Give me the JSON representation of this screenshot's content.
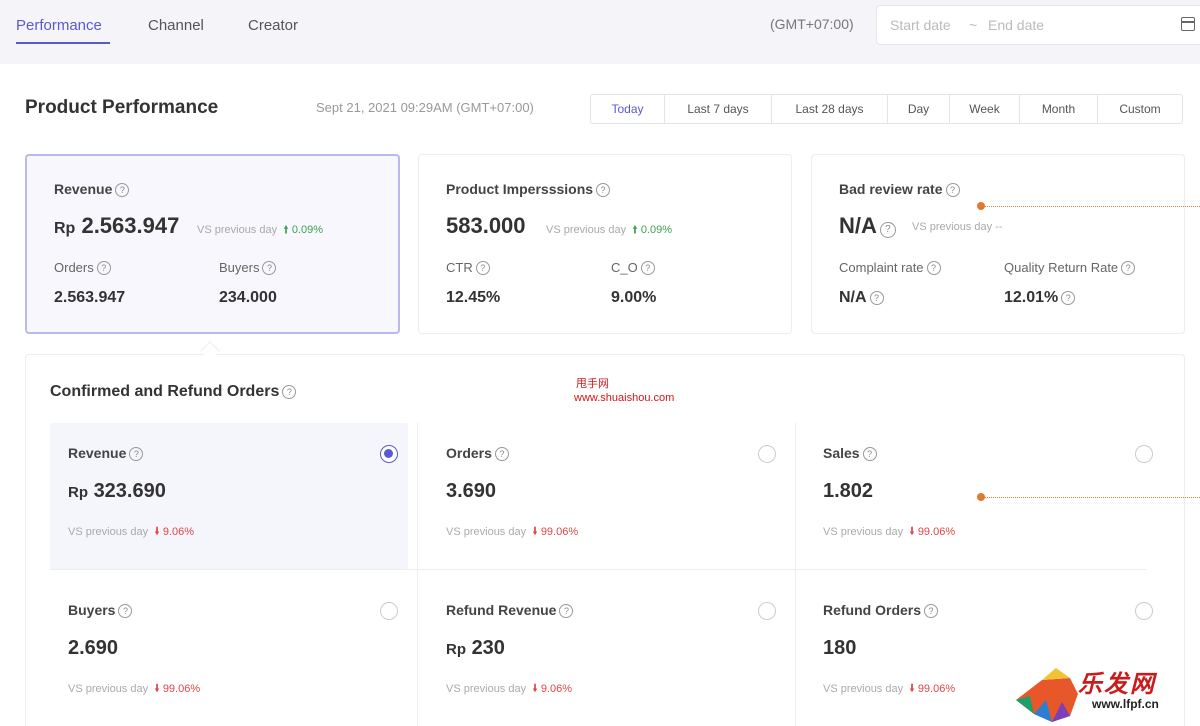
{
  "nav": {
    "tabs": [
      "Performance",
      "Channel",
      "Creator"
    ],
    "timezone": "(GMT+07:00)",
    "start_placeholder": "Start date",
    "separator": "~",
    "end_placeholder": "End date"
  },
  "product_performance": {
    "title": "Product Performance",
    "timestamp": "Sept 21, 2021 09:29AM (GMT+07:00)",
    "ranges": [
      "Today",
      "Last 7 days",
      "Last 28 days",
      "Day",
      "Week",
      "Month",
      "Custom"
    ]
  },
  "cards": {
    "revenue": {
      "label": "Revenue",
      "currency": "Rp",
      "value": "2.563.947",
      "vs": "VS previous day",
      "change": "0.09%",
      "orders_label": "Orders",
      "orders_value": "2.563.947",
      "buyers_label": "Buyers",
      "buyers_value": "234.000"
    },
    "impressions": {
      "label": "Product Impersssions",
      "value": "583.000",
      "vs": "VS previous day",
      "change": "0.09%",
      "ctr_label": "CTR",
      "ctr_value": "12.45%",
      "co_label": "C_O",
      "co_value": "9.00%"
    },
    "bad_review": {
      "label": "Bad review rate",
      "value": "N/A",
      "vs": "VS previous day --",
      "complaint_label": "Complaint rate",
      "complaint_value": "N/A",
      "quality_label": "Quality Return Rate",
      "quality_value": "12.01%"
    }
  },
  "confirmed": {
    "title": "Confirmed and Refund Orders",
    "metrics": [
      {
        "label": "Revenue",
        "currency": "Rp",
        "value": "323.690",
        "vs": "VS previous day",
        "change": "9.06%",
        "selected": true
      },
      {
        "label": "Orders",
        "currency": "",
        "value": "3.690",
        "vs": "VS previous day",
        "change": "99.06%",
        "selected": false
      },
      {
        "label": "Sales",
        "currency": "",
        "value": "1.802",
        "vs": "VS previous day",
        "change": "99.06%",
        "selected": false
      },
      {
        "label": "Buyers",
        "currency": "",
        "value": "2.690",
        "vs": "VS previous day",
        "change": "99.06%",
        "selected": false
      },
      {
        "label": "Refund Revenue",
        "currency": "Rp",
        "value": "230",
        "vs": "VS previous day",
        "change": "9.06%",
        "selected": false
      },
      {
        "label": "Refund Orders",
        "currency": "",
        "value": "180",
        "vs": "VS previous day",
        "change": "99.06%",
        "selected": false
      }
    ]
  },
  "watermark": {
    "cn": "甩手网",
    "url": "www.shuaishou.com",
    "logo_title": "乐发网",
    "logo_url": "www.lfpf.cn"
  },
  "colors": {
    "accent": "#5a5acf",
    "up": "#3ea052",
    "down": "#e04646",
    "annotation": "#e07a2f"
  }
}
